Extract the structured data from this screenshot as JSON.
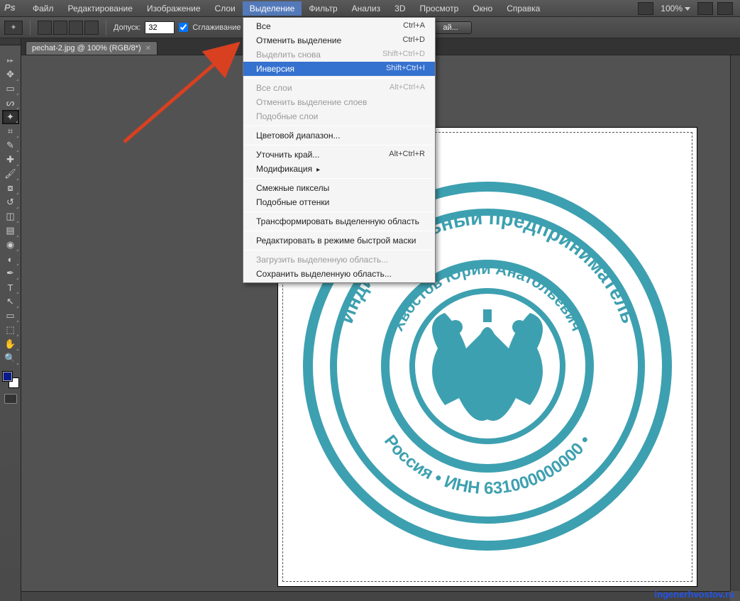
{
  "menubar": {
    "items": [
      "Файл",
      "Редактирование",
      "Изображение",
      "Слои",
      "Выделение",
      "Фильтр",
      "Анализ",
      "3D",
      "Просмотр",
      "Окно",
      "Справка"
    ],
    "active_index": 4,
    "zoom": "100%"
  },
  "optionsbar": {
    "tolerance_label": "Допуск:",
    "tolerance_value": "32",
    "antialias_label": "Сглаживание",
    "refine_label": "ай..."
  },
  "tab": {
    "title": "pechat-2.jpg @ 100% (RGB/8*)"
  },
  "dropdown": {
    "groups": [
      [
        {
          "label": "Все",
          "shortcut": "Ctrl+A",
          "enabled": true
        },
        {
          "label": "Отменить выделение",
          "shortcut": "Ctrl+D",
          "enabled": true
        },
        {
          "label": "Выделить снова",
          "shortcut": "Shift+Ctrl+D",
          "enabled": false
        },
        {
          "label": "Инверсия",
          "shortcut": "Shift+Ctrl+I",
          "enabled": true,
          "highlight": true
        }
      ],
      [
        {
          "label": "Все слои",
          "shortcut": "Alt+Ctrl+A",
          "enabled": false
        },
        {
          "label": "Отменить выделение слоев",
          "shortcut": "",
          "enabled": false
        },
        {
          "label": "Подобные слои",
          "shortcut": "",
          "enabled": false
        }
      ],
      [
        {
          "label": "Цветовой диапазон...",
          "shortcut": "",
          "enabled": true
        }
      ],
      [
        {
          "label": "Уточнить край...",
          "shortcut": "Alt+Ctrl+R",
          "enabled": true
        },
        {
          "label": "Модификация",
          "shortcut": "",
          "enabled": true,
          "submenu": true
        }
      ],
      [
        {
          "label": "Смежные пикселы",
          "shortcut": "",
          "enabled": true
        },
        {
          "label": "Подобные оттенки",
          "shortcut": "",
          "enabled": true
        }
      ],
      [
        {
          "label": "Трансформировать выделенную область",
          "shortcut": "",
          "enabled": true
        }
      ],
      [
        {
          "label": "Редактировать в режиме быстрой маски",
          "shortcut": "",
          "enabled": true
        }
      ],
      [
        {
          "label": "Загрузить выделенную область...",
          "shortcut": "",
          "enabled": false
        },
        {
          "label": "Сохранить выделенную область...",
          "shortcut": "",
          "enabled": true
        }
      ]
    ]
  },
  "tools": [
    "move",
    "marquee",
    "lasso",
    "wand",
    "crop",
    "eyedropper",
    "heal",
    "brush",
    "stamp",
    "history",
    "eraser",
    "gradient",
    "blur",
    "dodge",
    "pen",
    "type",
    "path",
    "shape",
    "3d",
    "hand",
    "zoom"
  ],
  "selected_tool_index": 3,
  "swatch": {
    "fg": "#0a1a8a",
    "bg": "#ffffff"
  },
  "watermark": "ingenerhvostov.ru",
  "stamp_text": {
    "outer_top": "Индивидуальный предприниматель",
    "outer_bottom": "Россия • ИНН 631000000000 •",
    "inner": "Хвостов Юрий Анатольевич"
  }
}
